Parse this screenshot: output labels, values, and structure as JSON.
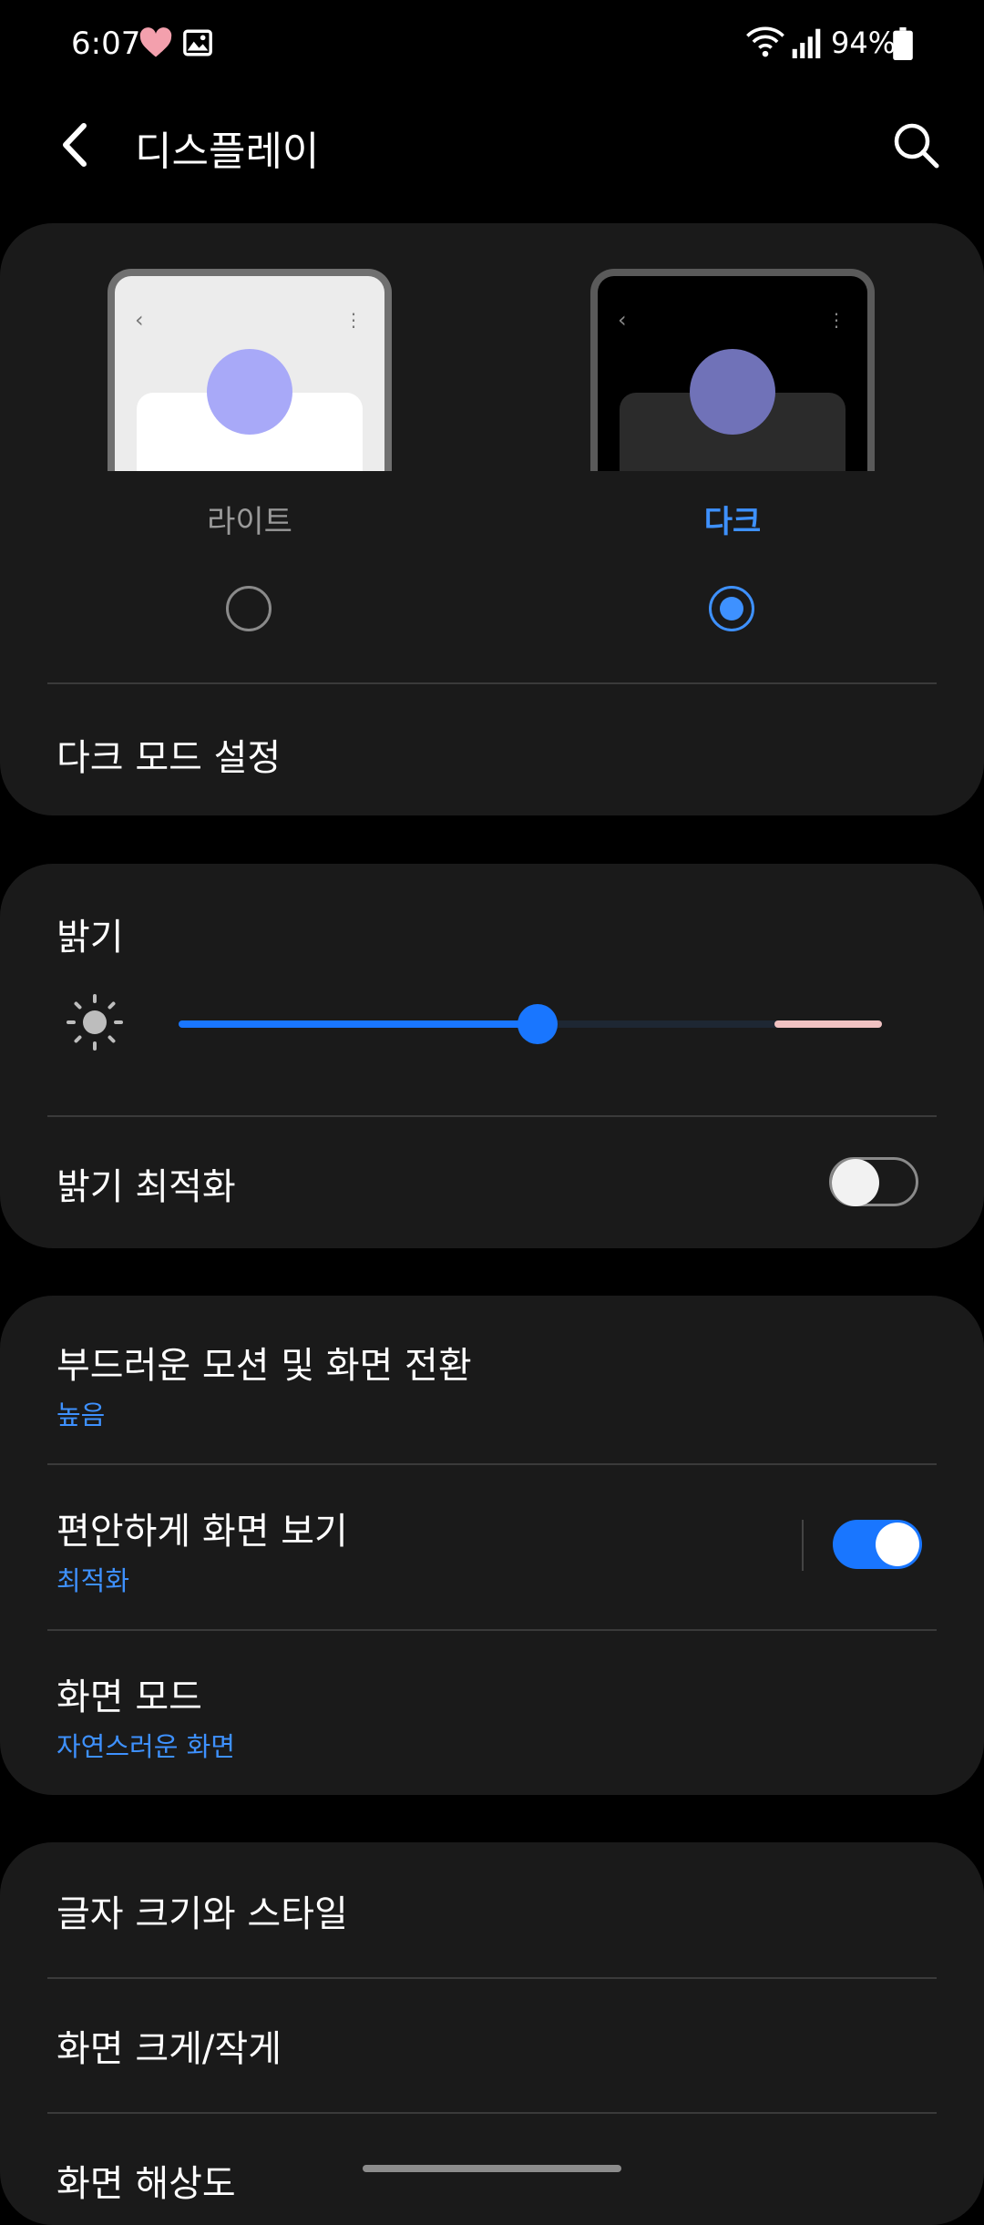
{
  "status_bar": {
    "time": "6:07",
    "battery": "94%"
  },
  "app_bar": {
    "title": "디스플레이"
  },
  "theme": {
    "light_label": "라이트",
    "dark_label": "다크",
    "selected": "dark",
    "dark_mode_settings": "다크 모드 설정"
  },
  "brightness": {
    "title": "밝기",
    "level_fraction": 0.51,
    "adaptive_label": "밝기 최적화",
    "adaptive_enabled": false
  },
  "motion": {
    "title": "부드러운 모션 및 화면 전환",
    "value": "높음"
  },
  "eye_comfort": {
    "title": "편안하게 화면 보기",
    "value": "최적화",
    "enabled": true
  },
  "screen_mode": {
    "title": "화면 모드",
    "value": "자연스러운 화면"
  },
  "font": {
    "title": "글자 크기와 스타일"
  },
  "zoom": {
    "title": "화면 크게/작게"
  },
  "resolution": {
    "title": "화면 해상도"
  },
  "colors": {
    "accent": "#3e91ff",
    "slider": "#1976ff",
    "card": "#1a1a1a",
    "background": "#000000"
  },
  "icons": [
    "heart-icon",
    "image-icon",
    "wifi-icon",
    "signal-icon",
    "battery-icon",
    "back-arrow-icon",
    "search-icon",
    "sun-icon"
  ]
}
